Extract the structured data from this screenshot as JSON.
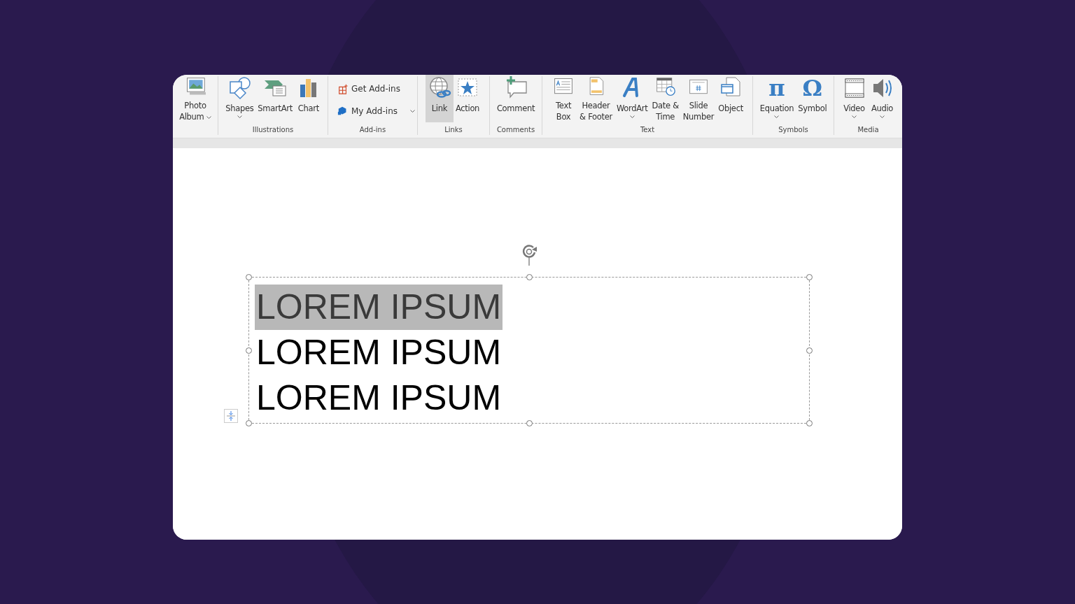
{
  "ribbon": {
    "groups": [
      {
        "buttons": [
          {
            "kind": "large",
            "lines": [
              "Photo",
              "Album"
            ],
            "dropdown": true,
            "selected": false
          }
        ]
      },
      {
        "label": "Illustrations",
        "buttons": [
          {
            "kind": "large",
            "lines": [
              "Shapes"
            ],
            "dropdown": true,
            "selected": false
          },
          {
            "kind": "large",
            "lines": [
              "SmartArt"
            ],
            "dropdown": false,
            "selected": false
          },
          {
            "kind": "large",
            "lines": [
              "Chart"
            ],
            "dropdown": false,
            "selected": false
          }
        ]
      },
      {
        "label": "Add-ins",
        "buttons": [
          {
            "kind": "small",
            "lines": [
              "Get Add-ins"
            ],
            "dropdown": false,
            "selected": false
          },
          {
            "kind": "small",
            "lines": [
              "My Add-ins"
            ],
            "dropdown": true,
            "selected": false
          }
        ]
      },
      {
        "label": "Links",
        "buttons": [
          {
            "kind": "large",
            "lines": [
              "Link"
            ],
            "dropdown": false,
            "selected": true
          },
          {
            "kind": "large",
            "lines": [
              "Action"
            ],
            "dropdown": false,
            "selected": false
          }
        ]
      },
      {
        "label": "Comments",
        "buttons": [
          {
            "kind": "large",
            "lines": [
              "Comment"
            ],
            "dropdown": false,
            "selected": false
          }
        ]
      },
      {
        "label": "Text",
        "buttons": [
          {
            "kind": "large",
            "lines": [
              "Text",
              "Box"
            ],
            "dropdown": false,
            "selected": false
          },
          {
            "kind": "large",
            "lines": [
              "Header",
              "& Footer"
            ],
            "dropdown": false,
            "selected": false
          },
          {
            "kind": "large",
            "lines": [
              "WordArt"
            ],
            "dropdown": true,
            "selected": false
          },
          {
            "kind": "large",
            "lines": [
              "Date &",
              "Time"
            ],
            "dropdown": false,
            "selected": false
          },
          {
            "kind": "large",
            "lines": [
              "Slide",
              "Number"
            ],
            "dropdown": false,
            "selected": false
          },
          {
            "kind": "large",
            "lines": [
              "Object"
            ],
            "dropdown": false,
            "selected": false
          }
        ]
      },
      {
        "label": "Symbols",
        "buttons": [
          {
            "kind": "glyph",
            "glyph": "π",
            "lines": [
              "Equation"
            ],
            "dropdown": true,
            "selected": false
          },
          {
            "kind": "glyph",
            "glyph": "Ω",
            "lines": [
              "Symbol"
            ],
            "dropdown": false,
            "selected": false
          }
        ]
      },
      {
        "label": "Media",
        "buttons": [
          {
            "kind": "large",
            "lines": [
              "Video"
            ],
            "dropdown": true,
            "selected": false
          },
          {
            "kind": "large",
            "lines": [
              "Audio"
            ],
            "dropdown": true,
            "selected": false
          }
        ]
      }
    ]
  },
  "slide": {
    "text_box": {
      "lines": [
        {
          "text": "LOREM IPSUM",
          "selected": true
        },
        {
          "text": "LOREM IPSUM",
          "selected": false
        },
        {
          "text": "LOREM IPSUM",
          "selected": false
        }
      ]
    }
  }
}
